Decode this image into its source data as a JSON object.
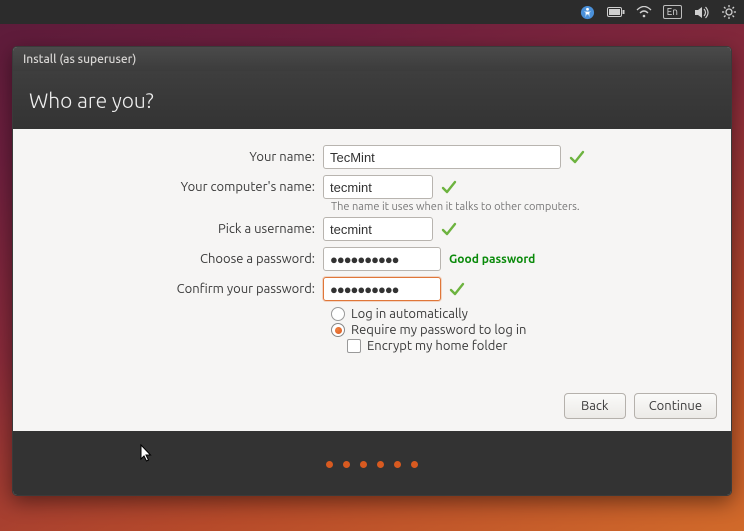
{
  "topbar": {
    "lang_badge": "En"
  },
  "window": {
    "title": "Install (as superuser)"
  },
  "header": {
    "title": "Who are you?"
  },
  "form": {
    "name_label": "Your name:",
    "name_value": "TecMint",
    "computer_label": "Your computer's name:",
    "computer_value": "tecmint",
    "computer_hint": "The name it uses when it talks to other computers.",
    "username_label": "Pick a username:",
    "username_value": "tecmint",
    "password_label": "Choose a password:",
    "password_value": "●●●●●●●●●●",
    "password_strength": "Good password",
    "confirm_label": "Confirm your password:",
    "confirm_value": "●●●●●●●●●●"
  },
  "options": {
    "auto_login": "Log in automatically",
    "require_pw": "Require my password to log in",
    "encrypt_home": "Encrypt my home folder",
    "selected": "require_pw"
  },
  "buttons": {
    "back": "Back",
    "continue": "Continue"
  }
}
